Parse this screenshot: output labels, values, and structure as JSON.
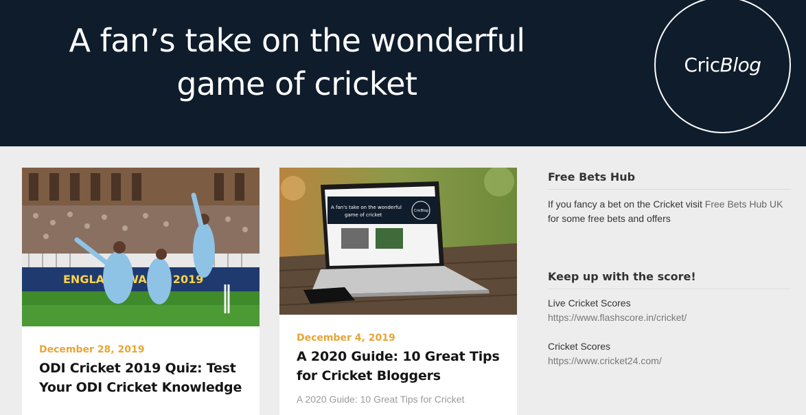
{
  "header": {
    "tagline_line1": "A fan’s take on the wonderful",
    "tagline_line2": "game of cricket",
    "logo_part1": "Cric",
    "logo_part2": "Blog"
  },
  "posts": [
    {
      "date": "December 28, 2019",
      "title": "ODI Cricket 2019 Quiz: Test Your ODI Cricket Knowledge",
      "image": "cricket-players-celebrating-photo"
    },
    {
      "date": "December 4, 2019",
      "title": "A 2020 Guide: 10 Great Tips for Cricket Bloggers",
      "excerpt": "A 2020 Guide: 10 Great Tips for Cricket",
      "image": "laptop-on-wooden-table-photo",
      "screen_tagline_line1": "A fan's take on the wonderful",
      "screen_tagline_line2": "game of cricket",
      "screen_logo": "CricBlog"
    }
  ],
  "sidebar": {
    "widget1": {
      "title": "Free Bets Hub",
      "text_before": "If you fancy a bet on the Cricket visit ",
      "link": "Free Bets Hub UK",
      "text_after": " for some free bets and offers"
    },
    "widget2": {
      "title": "Keep up with the score!",
      "links": [
        {
          "name": "Live Cricket Scores",
          "url": "https://www.flashscore.in/cricket/"
        },
        {
          "name": "Cricket Scores",
          "url": "https://www.cricket24.com/"
        }
      ]
    }
  }
}
